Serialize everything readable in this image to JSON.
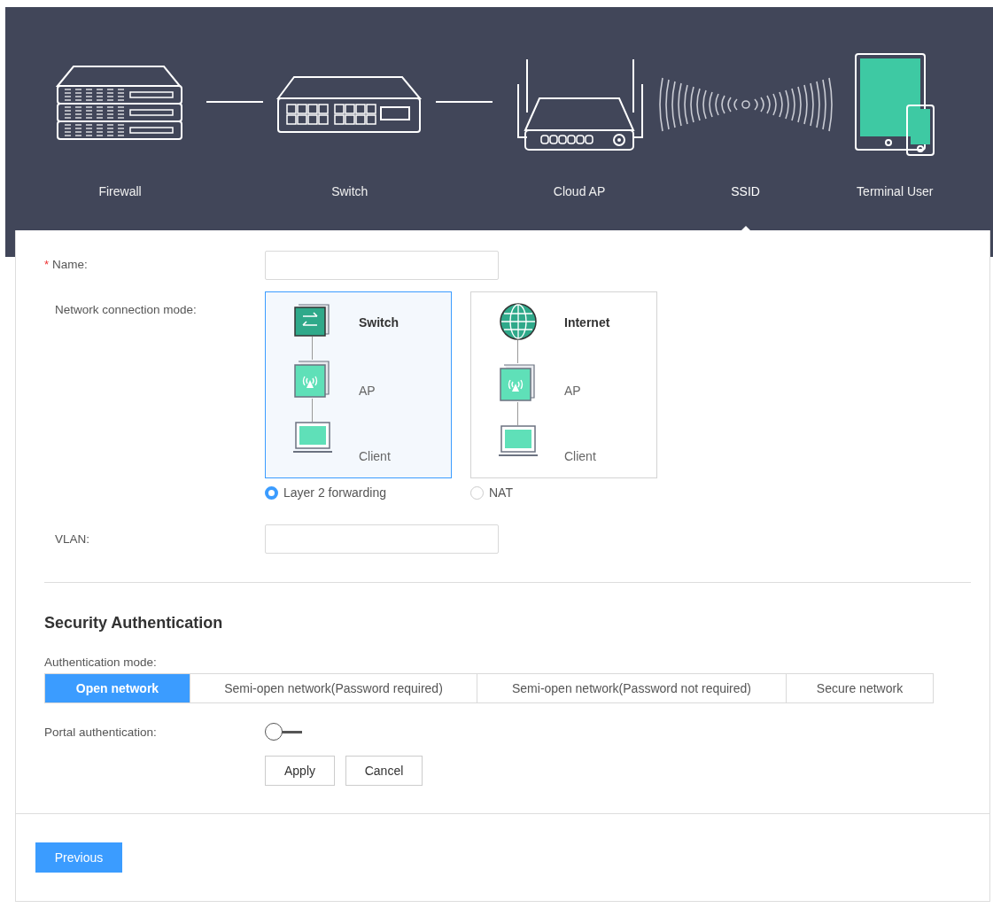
{
  "topology": {
    "steps": [
      {
        "kind": "firewall",
        "label": "Firewall",
        "selected": false
      },
      {
        "kind": "switch",
        "label": "Switch",
        "selected": false
      },
      {
        "kind": "cloud_ap",
        "label": "Cloud AP",
        "selected": false
      },
      {
        "kind": "ssid",
        "label": "SSID",
        "selected": true
      },
      {
        "kind": "terminal",
        "label": "Terminal User",
        "selected": false
      }
    ]
  },
  "form": {
    "name": {
      "required_mark": "*",
      "label": "Name:"
    },
    "connection_mode": {
      "label": "Network connection mode:",
      "options": [
        {
          "kind": "switch",
          "top": "Switch",
          "middle": "AP",
          "bottom": "Client",
          "label": "Layer 2 forwarding",
          "selected": true
        },
        {
          "kind": "internet",
          "top": "Internet",
          "middle": "AP",
          "bottom": "Client",
          "label": "NAT",
          "selected": false
        }
      ]
    },
    "vlan": {
      "label": "VLAN:"
    }
  },
  "security": {
    "title": "Security Authentication",
    "mode_label": "Authentication mode:",
    "modes": [
      {
        "label": "Open network",
        "selected": true
      },
      {
        "label": "Semi-open network(Password required)",
        "selected": false
      },
      {
        "label": "Semi-open network(Password not required)",
        "selected": false
      },
      {
        "label": "Secure network",
        "selected": false
      }
    ],
    "portal": {
      "label": "Portal authentication:",
      "on": false
    },
    "buttons": [
      "Apply",
      "Cancel"
    ]
  },
  "footer": {
    "button": "Previous"
  }
}
